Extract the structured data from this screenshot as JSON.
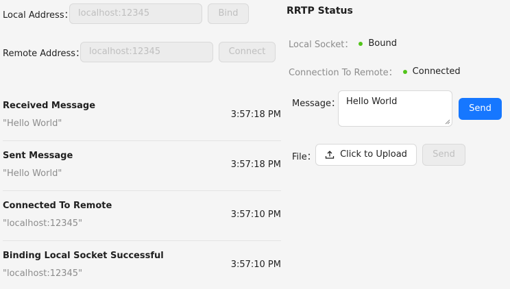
{
  "connection": {
    "local_address_label": "Local Address：",
    "local_address_value": "localhost:12345",
    "bind_label": "Bind",
    "remote_address_label": "Remote Address：",
    "remote_address_value": "localhost:12345",
    "connect_label": "Connect"
  },
  "messages": [
    {
      "title": "Received Message",
      "description": "\"Hello World\"",
      "time": "3:57:18 PM"
    },
    {
      "title": "Sent Message",
      "description": "\"Hello World\"",
      "time": "3:57:18 PM"
    },
    {
      "title": "Connected To Remote",
      "description": "\"localhost:12345\"",
      "time": "3:57:10 PM"
    },
    {
      "title": "Binding Local Socket Successful",
      "description": "\"localhost:12345\"",
      "time": "3:57:10 PM"
    }
  ],
  "status": {
    "title": "RRTP Status",
    "local_socket_label": "Local Socket：",
    "local_socket_value": "Bound",
    "connection_label": "Connection To Remote：",
    "connection_value": "Connected",
    "dot_color": "#52c41a"
  },
  "message_form": {
    "label": "Message：",
    "value": "Hello World",
    "send_label": "Send",
    "send_color": "#1677ff"
  },
  "file_form": {
    "label": "File：",
    "upload_label": "Click to Upload",
    "upload_icon": "upload-icon",
    "send_label": "Send"
  }
}
